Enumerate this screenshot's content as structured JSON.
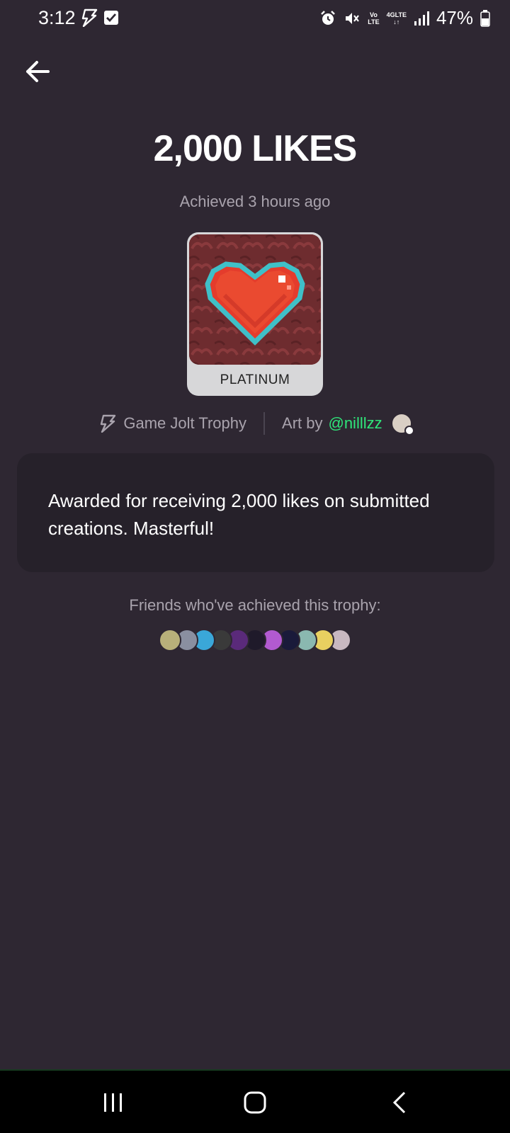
{
  "status_bar": {
    "time": "3:12",
    "network_top": "4GLTE",
    "volte_top": "Vo",
    "volte_bottom": "LTE",
    "battery": "47%"
  },
  "trophy": {
    "title": "2,000 LIKES",
    "achieved": "Achieved 3 hours ago",
    "tier": "PLATINUM",
    "source": "Game Jolt Trophy",
    "art_by_label": "Art by",
    "artist_handle": "@nilllzz",
    "description": "Awarded for receiving 2,000 likes on submitted creations. Masterful!"
  },
  "friends": {
    "label": "Friends who've achieved this trophy:",
    "avatar_colors": [
      "#b8b07a",
      "#8a8fa0",
      "#3aa7d8",
      "#3a3a3a",
      "#5a2a7a",
      "#1f1a2a",
      "#b25ad0",
      "#1a1a3a",
      "#8ab8b0",
      "#e8d060",
      "#c8b8c0"
    ]
  },
  "colors": {
    "background": "#2e2732",
    "card": "#26212a",
    "accent_green": "#2fe67a",
    "muted_text": "#a9a3ad",
    "tier_badge": "#d7d7d9"
  },
  "icons": {
    "back": "arrow-left-icon",
    "gamejolt": "lightning-bolt-icon",
    "nav_recents": "recents-icon",
    "nav_home": "home-icon",
    "nav_back": "chevron-left-icon"
  }
}
